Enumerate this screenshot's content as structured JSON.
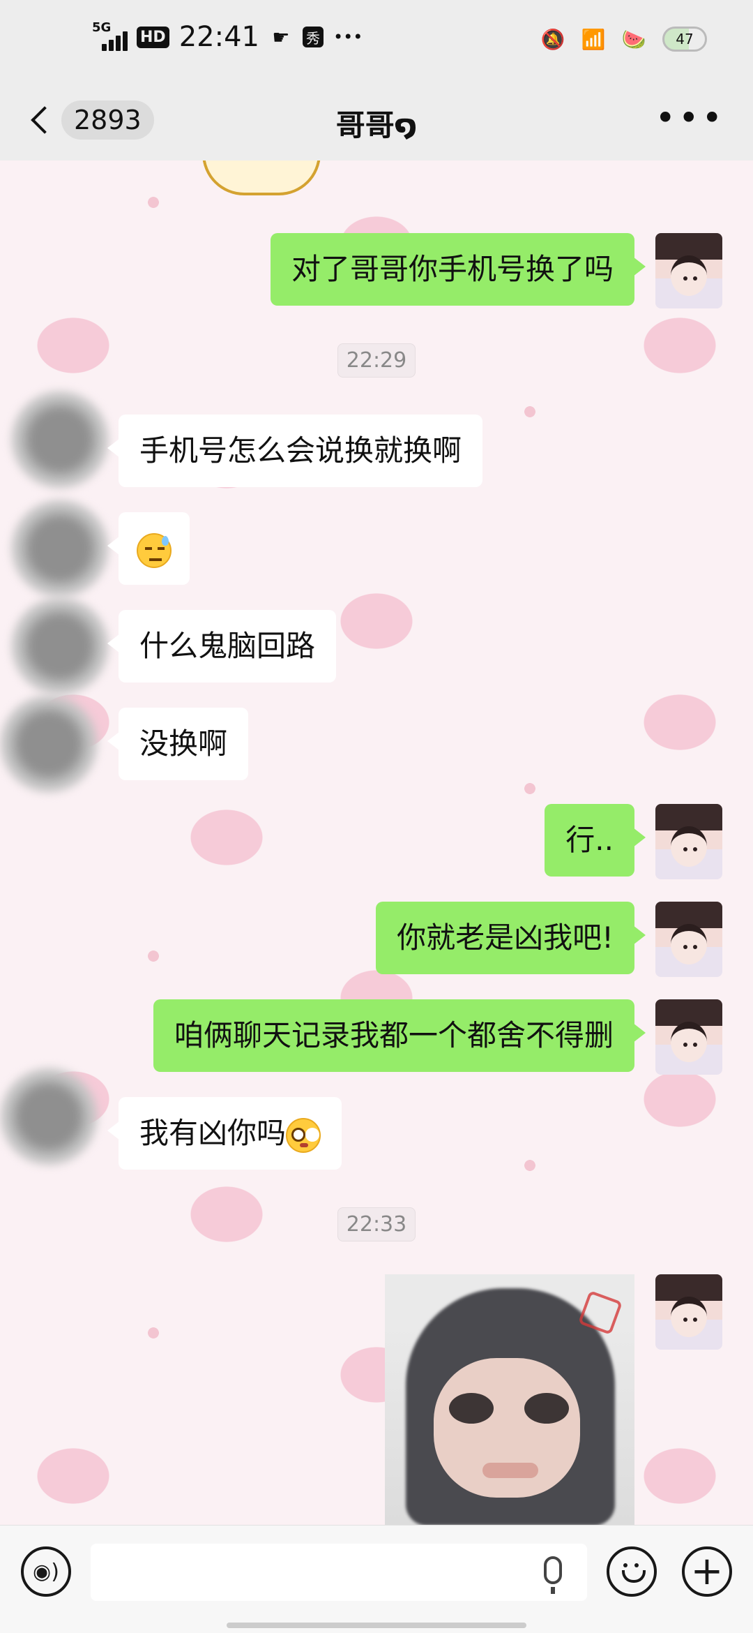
{
  "status_bar": {
    "network": "5G",
    "hd": "HD",
    "time": "22:41",
    "xiu": "秀",
    "more": "•••",
    "battery": "47"
  },
  "nav": {
    "unread_count": "2893",
    "title": "哥哥໑",
    "more": "•••"
  },
  "messages": [
    {
      "side": "me",
      "text": "对了哥哥你手机号换了吗"
    },
    {
      "type": "timestamp",
      "text": "22:29"
    },
    {
      "side": "other",
      "text": "手机号怎么会说换就换啊"
    },
    {
      "side": "other",
      "emoji": "sweat-smile-emoji"
    },
    {
      "side": "other",
      "text": "什么鬼脑回路"
    },
    {
      "side": "other",
      "text": "没换啊"
    },
    {
      "side": "me",
      "text": "行.."
    },
    {
      "side": "me",
      "text": "你就老是凶我吧!"
    },
    {
      "side": "me",
      "text": "咱俩聊天记录我都一个都舍不得删"
    },
    {
      "side": "other",
      "text": "我有凶你吗",
      "emoji": "flushed-emoji"
    },
    {
      "type": "timestamp",
      "text": "22:33"
    },
    {
      "side": "me",
      "image": "photo-message"
    }
  ],
  "input": {
    "placeholder": "",
    "value": ""
  },
  "colors": {
    "my_bubble": "#95ec69",
    "their_bubble": "#ffffff",
    "chat_bg": "#fbf1f4"
  }
}
